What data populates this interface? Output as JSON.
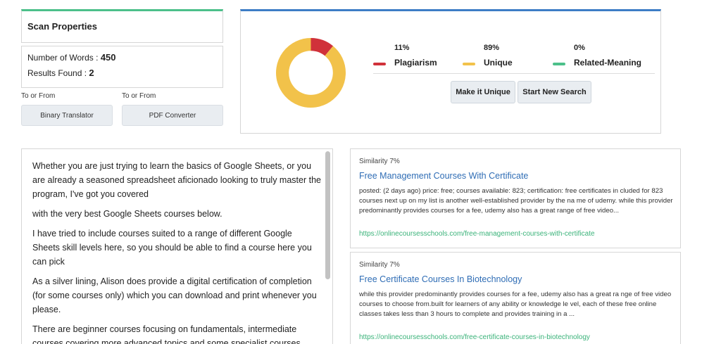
{
  "scan": {
    "title": "Scan Properties",
    "words_label": "Number of Words :",
    "words_value": "450",
    "results_label": "Results Found :",
    "results_value": "2"
  },
  "tools": [
    {
      "label": "To or From",
      "button": "Binary Translator"
    },
    {
      "label": "To or From",
      "button": "PDF Converter"
    }
  ],
  "result": {
    "legend": [
      {
        "percent": "11%",
        "name": "Plagiarism",
        "color": "#d0313a",
        "value": 11
      },
      {
        "percent": "89%",
        "name": "Unique",
        "color": "#f2c24a",
        "value": 89
      },
      {
        "percent": "0%",
        "name": "Related-Meaning",
        "color": "#4cc08a",
        "value": 0
      }
    ],
    "make_unique": "Make it Unique",
    "new_search": "Start New Search"
  },
  "content": {
    "paragraphs": [
      "Whether you are just trying to learn the basics of Google Sheets, or you are already a seasoned spreadsheet aficionado looking to truly master the program, I've got you covered",
      "with the very best Google Sheets courses below.",
      "I have tried to include courses suited to a range of different Google Sheets skill levels here, so you should be able to find a course here you can pick",
      "As a silver lining, Alison does provide a digital certification of completion (for some courses only) which you can download and print whenever you please.",
      "There are beginner courses focusing on fundamentals, intermediate courses covering more advanced topics and some specialist courses"
    ]
  },
  "matches": [
    {
      "similarity": "Similarity 7%",
      "title": "Free Management Courses With Certificate",
      "description": "posted: (2 days ago) price: free; courses available: 823; certification: free certificates in cluded for 823 courses next up on my list is another well-established provider by the na me of udemy. while this provider predominantly provides courses for a fee, udemy also has a great range of free video...",
      "url": "https://onlinecoursesschools.com/free-management-courses-with-certificate"
    },
    {
      "similarity": "Similarity 7%",
      "title": "Free Certificate Courses In Biotechnology",
      "description": "while this provider predominantly provides courses for a fee, udemy also has a great ra nge of free video courses to choose from.built for learners of any ability or knowledge le vel, each of these free online classes takes less than 3 hours to complete and provides training in a ...",
      "url": "https://onlinecoursesschools.com/free-certificate-courses-in-biotechnology"
    }
  ]
}
